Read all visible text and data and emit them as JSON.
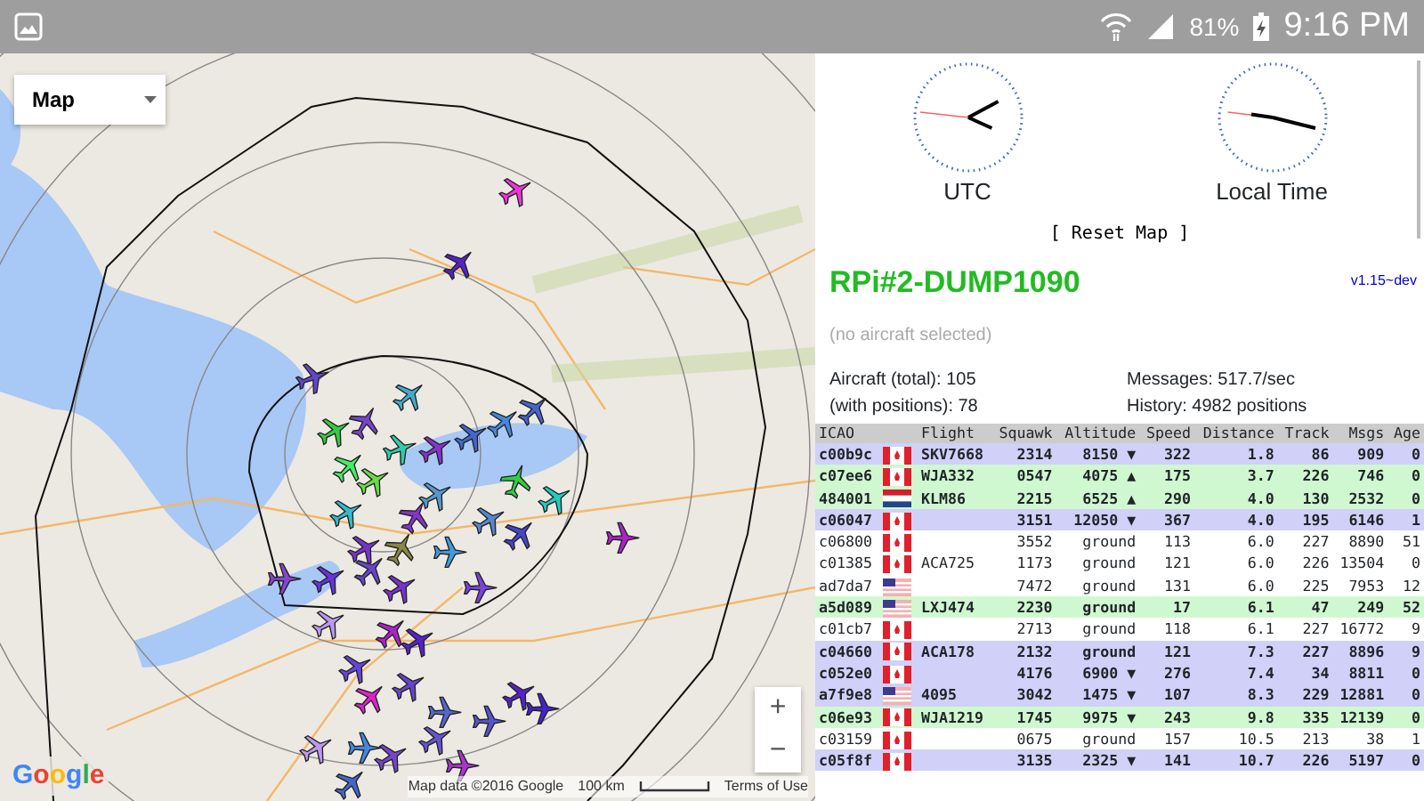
{
  "status_bar": {
    "battery": "81%",
    "time": "9:16 PM"
  },
  "map": {
    "type_control": "Map",
    "zoom_in": "+",
    "zoom_out": "−",
    "logo": "Google",
    "attribution": "Map data ©2016 Google",
    "scale": "100 km",
    "terms": "Terms of Use"
  },
  "clocks": [
    {
      "label": "UTC"
    },
    {
      "label": "Local Time"
    }
  ],
  "reset_button": "[ Reset Map ]",
  "site_title": "RPi#2-DUMP1090",
  "version": "v1.15~dev",
  "selection": "(no aircraft selected)",
  "stats": [
    "Aircraft (total): 105",
    "Messages: 517.7/sec",
    "(with positions): 78",
    "History: 4982 positions"
  ],
  "table": {
    "columns": [
      "ICAO",
      "Flight",
      "Squawk",
      "Altitude",
      "Speed",
      "Distance",
      "Track",
      "Msgs",
      "Age"
    ],
    "rows": [
      {
        "icao": "c00b9c",
        "flag": {
          "kind": "ca"
        },
        "flight": "SKV7668",
        "squawk": "2314",
        "altitude": "8150 ▼",
        "speed": "322",
        "distance": "1.8",
        "track": "86",
        "msgs": "909",
        "age": "0",
        "color": "#d0d0f8"
      },
      {
        "icao": "c07ee6",
        "flag": {
          "kind": "ca"
        },
        "flight": "WJA332",
        "squawk": "0547",
        "altitude": "4075 ▲",
        "speed": "175",
        "distance": "3.7",
        "track": "226",
        "msgs": "746",
        "age": "0",
        "color": "#d0f8d0"
      },
      {
        "icao": "484001",
        "flag": {
          "kind": "nl"
        },
        "flight": "KLM86",
        "squawk": "2215",
        "altitude": "6525 ▲",
        "speed": "290",
        "distance": "4.0",
        "track": "130",
        "msgs": "2532",
        "age": "0",
        "color": "#d0f8d0"
      },
      {
        "icao": "c06047",
        "flag": {
          "kind": "ca"
        },
        "squawk": "3151",
        "altitude": "12050 ▼",
        "speed": "367",
        "distance": "4.0",
        "track": "195",
        "msgs": "6146",
        "age": "1",
        "color": "#d0d0f8"
      },
      {
        "icao": "c06800",
        "flag": {
          "kind": "ca"
        },
        "squawk": "3552",
        "altitude": "ground",
        "speed": "113",
        "distance": "6.0",
        "track": "227",
        "msgs": "8890",
        "age": "51",
        "color": "#ffffff"
      },
      {
        "icao": "c01385",
        "flag": {
          "kind": "ca"
        },
        "flight": "ACA725",
        "squawk": "1173",
        "altitude": "ground",
        "speed": "121",
        "distance": "6.0",
        "track": "226",
        "msgs": "13504",
        "age": "0",
        "color": "#ffffff"
      },
      {
        "icao": "ad7da7",
        "flag": {
          "kind": "us"
        },
        "squawk": "7472",
        "altitude": "ground",
        "speed": "131",
        "distance": "6.0",
        "track": "225",
        "msgs": "7953",
        "age": "12",
        "color": "#ffffff"
      },
      {
        "icao": "a5d089",
        "flag": {
          "kind": "us"
        },
        "flight": "LXJ474",
        "squawk": "2230",
        "altitude": "ground",
        "speed": "17",
        "distance": "6.1",
        "track": "47",
        "msgs": "249",
        "age": "52",
        "color": "#d0f8d0"
      },
      {
        "icao": "c01cb7",
        "flag": {
          "kind": "ca"
        },
        "squawk": "2713",
        "altitude": "ground",
        "speed": "118",
        "distance": "6.1",
        "track": "227",
        "msgs": "16772",
        "age": "9",
        "color": "#ffffff"
      },
      {
        "icao": "c04660",
        "flag": {
          "kind": "ca"
        },
        "flight": "ACA178",
        "squawk": "2132",
        "altitude": "ground",
        "speed": "121",
        "distance": "7.3",
        "track": "227",
        "msgs": "8896",
        "age": "9",
        "color": "#d0d0f8"
      },
      {
        "icao": "c052e0",
        "flag": {
          "kind": "ca"
        },
        "squawk": "4176",
        "altitude": "6900 ▼",
        "speed": "276",
        "distance": "7.4",
        "track": "34",
        "msgs": "8811",
        "age": "0",
        "color": "#d0d0f8"
      },
      {
        "icao": "a7f9e8",
        "flag": {
          "kind": "us"
        },
        "flight": "4095",
        "squawk": "3042",
        "altitude": "1475 ▼",
        "speed": "107",
        "distance": "8.3",
        "track": "229",
        "msgs": "12881",
        "age": "0",
        "color": "#d0d0f8"
      },
      {
        "icao": "c06e93",
        "flag": {
          "kind": "ca"
        },
        "flight": "WJA1219",
        "squawk": "1745",
        "altitude": "9975 ▼",
        "speed": "243",
        "distance": "9.8",
        "track": "335",
        "msgs": "12139",
        "age": "0",
        "color": "#d0f8d0"
      },
      {
        "icao": "c03159",
        "flag": {
          "kind": "ca"
        },
        "squawk": "0675",
        "altitude": "ground",
        "speed": "157",
        "distance": "10.5",
        "track": "213",
        "msgs": "38",
        "age": "1",
        "color": "#ffffff"
      },
      {
        "icao": "c05f8f",
        "flag": {
          "kind": "ca"
        },
        "squawk": "3135",
        "altitude": "2325 ▼",
        "speed": "141",
        "distance": "10.7",
        "track": "226",
        "msgs": "5197",
        "age": "0",
        "color": "#d0d0f8"
      }
    ]
  }
}
